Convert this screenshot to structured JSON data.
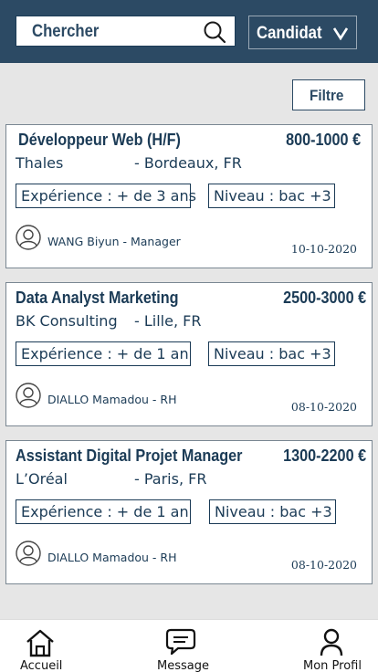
{
  "header": {
    "search_placeholder": "Chercher",
    "role_label": "Candidat",
    "role_chevron": "v"
  },
  "filter_label": "Filtre",
  "jobs": [
    {
      "title": "Développeur Web (H/F)",
      "salary": "800-1000 €",
      "company": "Thales",
      "location": "- Bordeaux, FR",
      "experience": "Expérience : + de 3 ans",
      "level": "Niveau : bac +3",
      "recruiter": "WANG Biyun - Manager",
      "date": "10-10-2020"
    },
    {
      "title": "Data Analyst Marketing",
      "salary": "2500-3000 €",
      "company": "BK Consulting",
      "location": "- Lille, FR",
      "experience": "Expérience : + de 1 an",
      "level": "Niveau : bac +3",
      "recruiter": "DIALLO Mamadou - RH",
      "date": "08-10-2020"
    },
    {
      "title": "Assistant Digital Projet Manager",
      "salary": "1300-2200 €",
      "company": "L’Oréal",
      "location": "- Paris, FR",
      "experience": "Expérience : + de 1 an",
      "level": "Niveau : bac +3",
      "recruiter": "DIALLO Mamadou - RH",
      "date": "08-10-2020"
    }
  ],
  "bottom_nav": {
    "home": "Accueil",
    "message": "Message",
    "profile": "Mon Profil"
  },
  "colors": {
    "header_bg": "#2c4a64",
    "text_primary": "#1b3b56",
    "page_bg": "#e6e6e6"
  },
  "icons": [
    "search-icon",
    "chevron-down-icon",
    "user-icon",
    "home-icon",
    "message-icon",
    "profile-icon"
  ]
}
